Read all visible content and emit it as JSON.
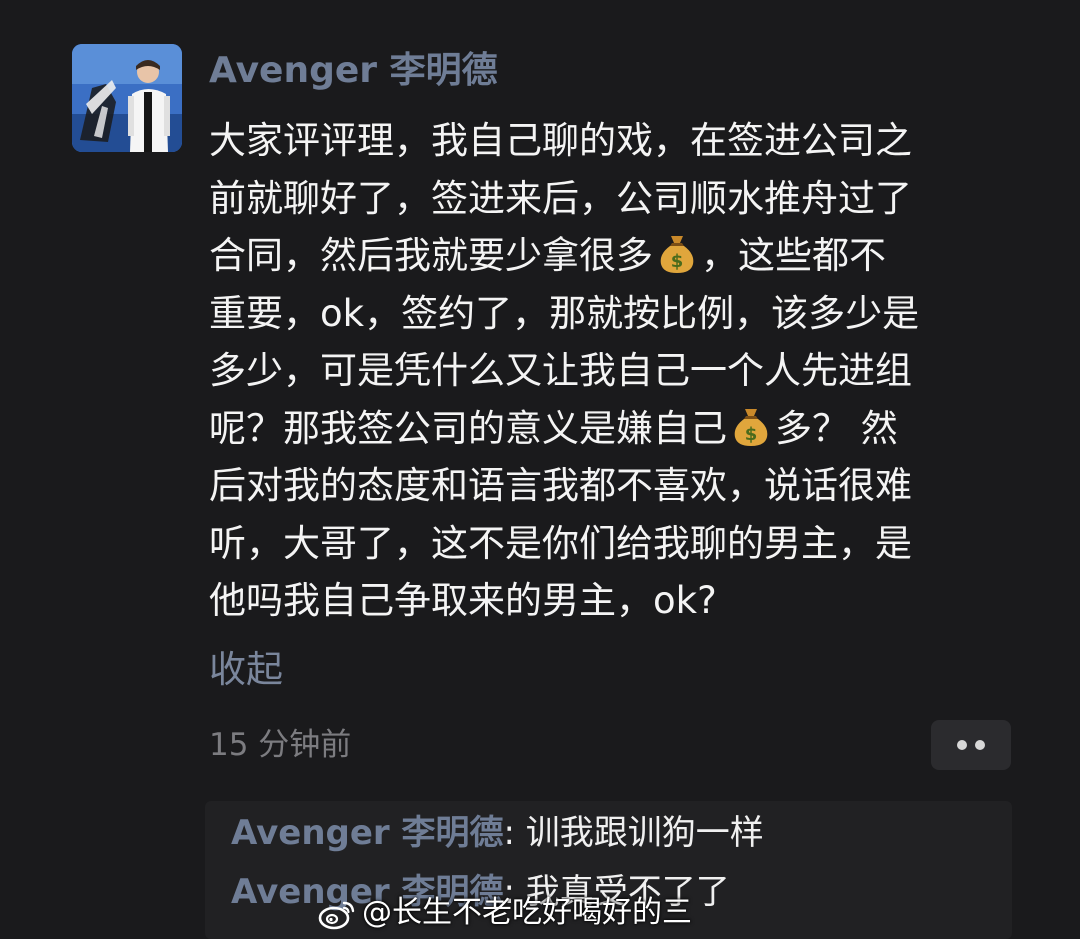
{
  "comment": {
    "author": "Avenger 李明德",
    "lines": [
      "大家评评理，我自己聊的戏，在签进公司之",
      "前就聊好了，签进来后，公司顺水推舟过了"
    ],
    "line3_a": "合同，然后我就要少拿很多",
    "line3_b": "，这些都不",
    "lines_mid": [
      "重要，ok，签约了，那就按比例，该多少是",
      "多少，可是凭什么又让我自己一个人先进组"
    ],
    "line6_a": "呢？那我签公司的意义是嫌自己",
    "line6_b": "多？ 然",
    "lines_end": [
      "后对我的态度和语言我都不喜欢，说话很难",
      "听，大哥了，这不是你们给我聊的男主，是",
      "他吗我自己争取来的男主，ok?"
    ],
    "collapse_label": "收起",
    "timestamp": "15 分钟前"
  },
  "replies": [
    {
      "author": "Avenger 李明德",
      "text": ": 训我跟训狗一样"
    },
    {
      "author": "Avenger 李明德",
      "text": ": 我真受不了了"
    }
  ],
  "watermark": "@长生不老吃好喝好的三",
  "icons": {
    "avatar": "user-avatar-photo",
    "money": "money-bag-icon",
    "more": "more-dots-icon",
    "watermark_logo": "weibo-logo-icon"
  },
  "colors": {
    "background": "#1a1a1c",
    "author": "#6f7d96",
    "text": "#f4f4f4",
    "muted": "#7c7c80",
    "reply_background": "#212123"
  }
}
